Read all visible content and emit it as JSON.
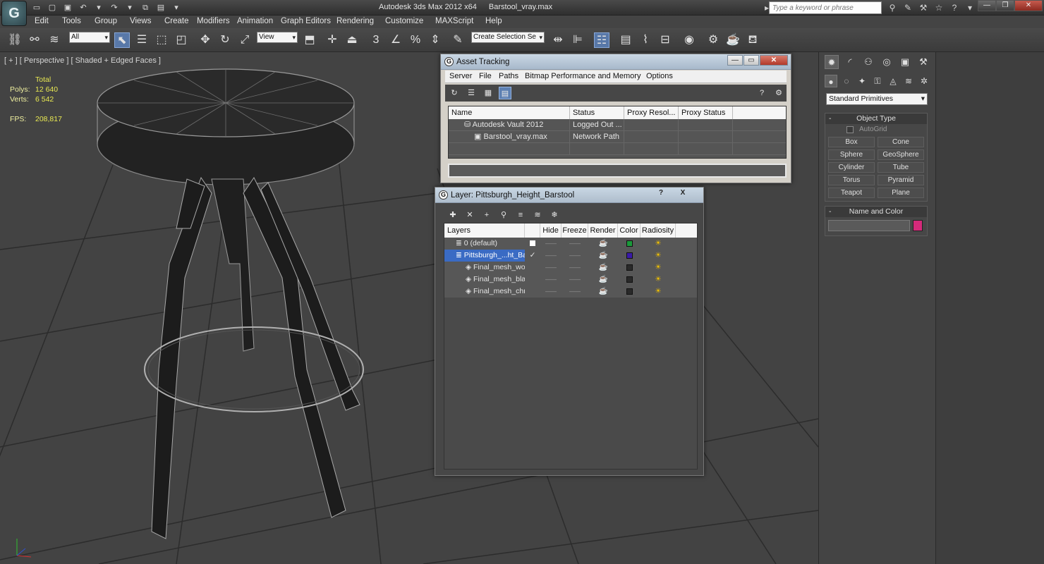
{
  "window": {
    "app_title": "Autodesk 3ds Max  2012 x64",
    "file_title": "Barstool_vray.max",
    "search_placeholder": "Type a keyword or phrase"
  },
  "menus": [
    "Edit",
    "Tools",
    "Group",
    "Views",
    "Create",
    "Modifiers",
    "Animation",
    "Graph Editors",
    "Rendering",
    "Customize",
    "MAXScript",
    "Help"
  ],
  "toolbar": {
    "selection_filter": "All",
    "ref_coord": "View",
    "named_selection_placeholder": "Create Selection Se"
  },
  "viewport": {
    "label": "[ + ] [ Perspective ] [ Shaded + Edged Faces ]",
    "stats_total": "Total",
    "polys_label": "Polys:",
    "polys_value": "12 640",
    "verts_label": "Verts:",
    "verts_value": "6 542",
    "fps_label": "FPS:",
    "fps_value": "208,817"
  },
  "command_panel": {
    "category": "Standard Primitives",
    "object_type_title": "Object Type",
    "autogrid": "AutoGrid",
    "buttons": [
      "Box",
      "Cone",
      "Sphere",
      "GeoSphere",
      "Cylinder",
      "Tube",
      "Torus",
      "Pyramid",
      "Teapot",
      "Plane"
    ],
    "name_color_title": "Name and Color",
    "object_color": "#d42a7a"
  },
  "asset_tracking": {
    "title": "Asset Tracking",
    "menus": [
      "Server",
      "File",
      "Paths",
      "Bitmap Performance and Memory",
      "Options"
    ],
    "columns": [
      "Name",
      "Status",
      "Proxy Resol...",
      "Proxy Status"
    ],
    "rows": [
      {
        "name": "Autodesk Vault 2012",
        "status": "Logged Out ..."
      },
      {
        "name": "Barstool_vray.max",
        "status": "Network Path"
      }
    ]
  },
  "layer_dialog": {
    "title": "Layer: Pittsburgh_Height_Barstool",
    "help": "?",
    "close": "X",
    "columns": [
      "Layers",
      "Hide",
      "Freeze",
      "Render",
      "Color",
      "Radiosity"
    ],
    "rows": [
      {
        "name": "0 (default)",
        "color": "#1a9a3a"
      },
      {
        "name": "Pittsburgh_...ht_Ba",
        "color": "#3a1aa8"
      },
      {
        "name": "Final_mesh_woo",
        "color": "#2a2a2a"
      },
      {
        "name": "Final_mesh_blacl",
        "color": "#2a2a2a"
      },
      {
        "name": "Final_mesh_chro",
        "color": "#2a2a2a"
      }
    ]
  }
}
